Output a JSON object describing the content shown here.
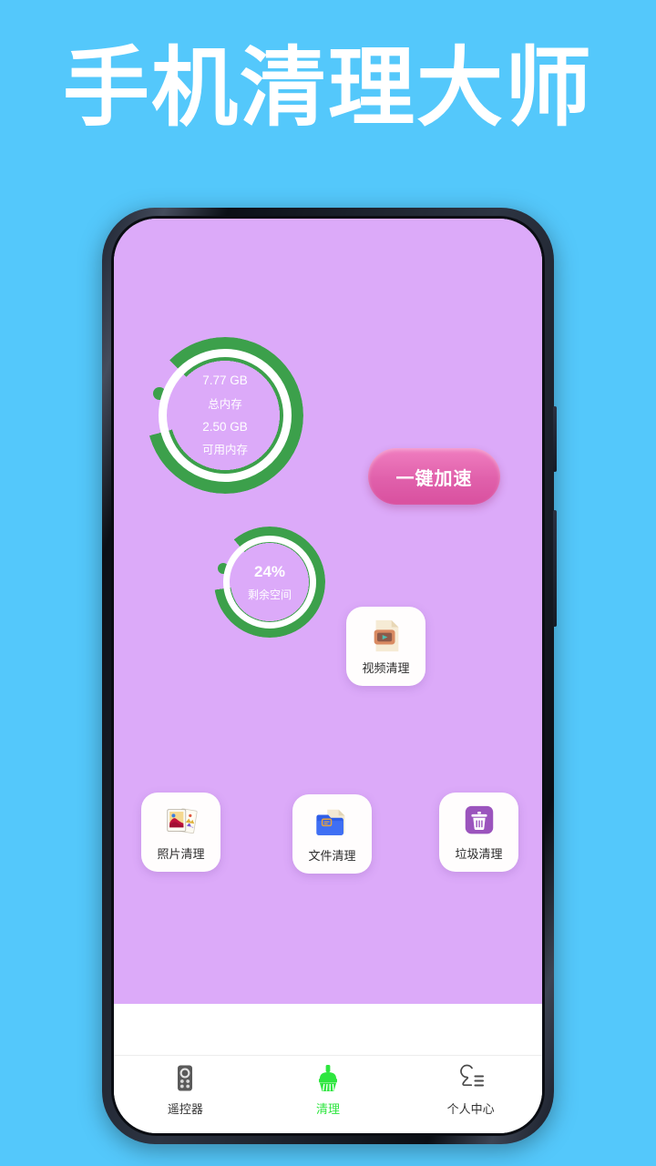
{
  "hero": {
    "title": "手机清理大师"
  },
  "app": {
    "memory_ring": {
      "total_value": "7.77 GB",
      "total_label": "总内存",
      "available_value": "2.50 GB",
      "available_label": "可用内存",
      "arc_color": "#3ca04b",
      "inner_ring_color": "#ffffff",
      "progress_percent": 83
    },
    "storage_ring": {
      "value": "24%",
      "label": "剩余空间",
      "arc_color": "#3ca04b",
      "inner_ring_color": "#ffffff",
      "progress_percent": 84
    },
    "boost_button": {
      "label": "一键加速",
      "color": "#e060ab"
    },
    "cards": [
      {
        "id": "video",
        "label": "视频清理",
        "icon": "video-file-icon"
      },
      {
        "id": "photo",
        "label": "照片清理",
        "icon": "photos-stack-icon"
      },
      {
        "id": "file",
        "label": "文件清理",
        "icon": "folder-icon"
      },
      {
        "id": "trash",
        "label": "垃圾清理",
        "icon": "trash-bin-icon"
      }
    ],
    "background_color": "#dcaaf9"
  },
  "nav": {
    "items": [
      {
        "id": "remote",
        "label": "遥控器",
        "icon": "remote-control-icon",
        "active": false
      },
      {
        "id": "clean",
        "label": "清理",
        "icon": "broom-icon",
        "active": true
      },
      {
        "id": "profile",
        "label": "个人中心",
        "icon": "person-menu-icon",
        "active": false
      }
    ],
    "active_color": "#2ee63f",
    "inactive_color": "#333333"
  },
  "page": {
    "background_color": "#54c8fb"
  }
}
